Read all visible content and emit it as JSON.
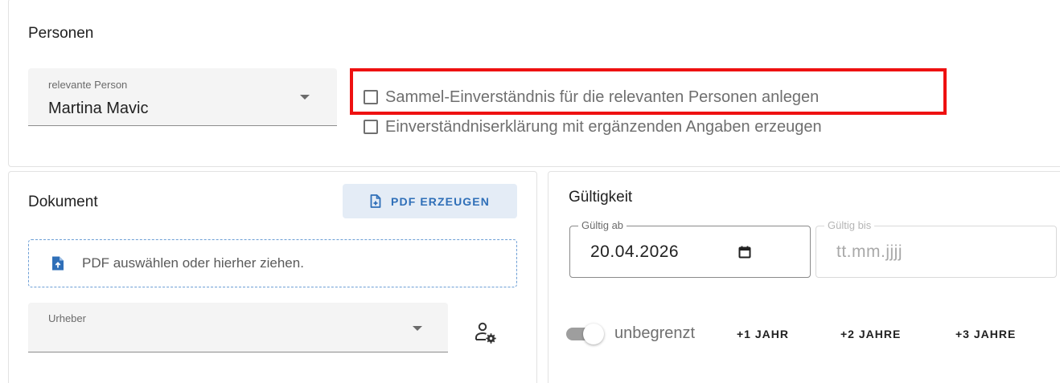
{
  "personen": {
    "title": "Personen",
    "select": {
      "label": "relevante Person",
      "value": "Martina Mavic"
    },
    "checkboxes": [
      {
        "label": "Sammel-Einverständnis für die relevanten Personen anlegen",
        "checked": false,
        "highlighted": true
      },
      {
        "label": "Einverständniserklärung mit ergänzenden Angaben erzeugen",
        "checked": false,
        "highlighted": false
      }
    ]
  },
  "dokument": {
    "title": "Dokument",
    "pdf_button_label": "PDF ERZEUGEN",
    "dropzone_text": "PDF auswählen oder hierher ziehen.",
    "urheber_label": "Urheber",
    "urheber_value": ""
  },
  "gueltigkeit": {
    "title": "Gültigkeit",
    "gueltig_ab": {
      "label": "Gültig ab",
      "value": "20.04.2026"
    },
    "gueltig_bis": {
      "label": "Gültig bis",
      "placeholder": "tt.mm.jjjj"
    },
    "unbegrenzt_label": "unbegrenzt",
    "unbegrenzt_on": false,
    "quick_buttons": [
      "+1 JAHR",
      "+2 JAHRE",
      "+3 JAHRE"
    ]
  },
  "colors": {
    "accent": "#2f6fb8",
    "highlight": "#ee1111"
  },
  "icons": {
    "pdf_button": "file-plus-icon",
    "dropzone": "file-upload-icon",
    "urheber_action": "account-cog-icon",
    "calendar": "calendar-icon"
  }
}
